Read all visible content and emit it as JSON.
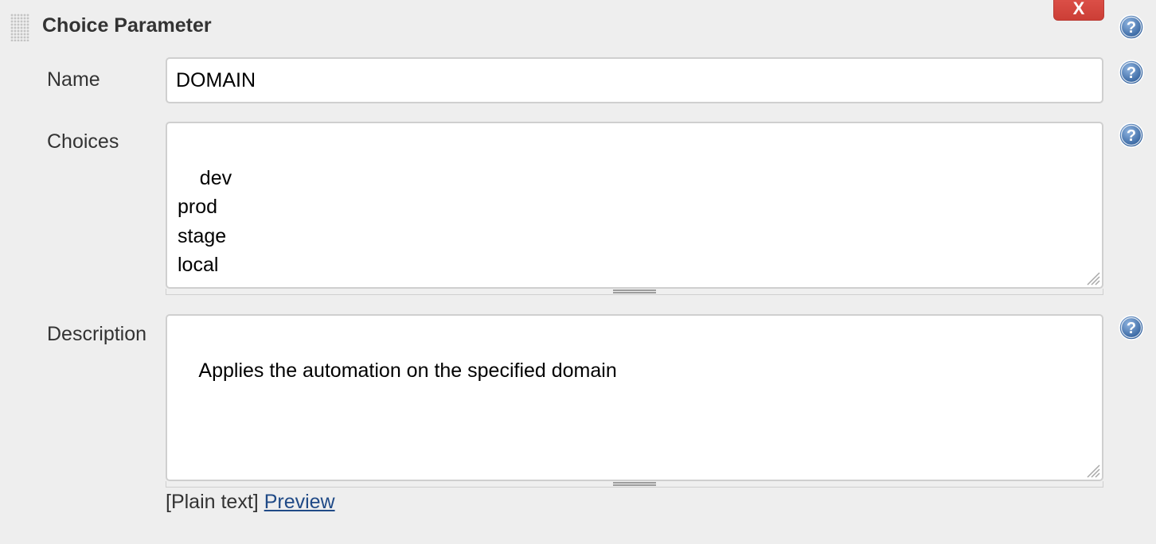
{
  "section": {
    "title": "Choice Parameter",
    "delete_label": "X",
    "delete_color": "#d9534f"
  },
  "fields": {
    "name": {
      "label": "Name",
      "value": "DOMAIN"
    },
    "choices": {
      "label": "Choices",
      "value": "dev\nprod\nstage\nlocal"
    },
    "description": {
      "label": "Description",
      "value": "Applies the automation on the specified domain"
    }
  },
  "format": {
    "plain_text_label": "[Plain text]",
    "preview_label": "Preview"
  },
  "icons": {
    "help": "help-icon",
    "drag": "drag-handle-icon",
    "resize": "resize-grip-icon"
  },
  "colors": {
    "help_blue": "#3a6ea8",
    "link": "#204a87",
    "background": "#eeeeee"
  }
}
